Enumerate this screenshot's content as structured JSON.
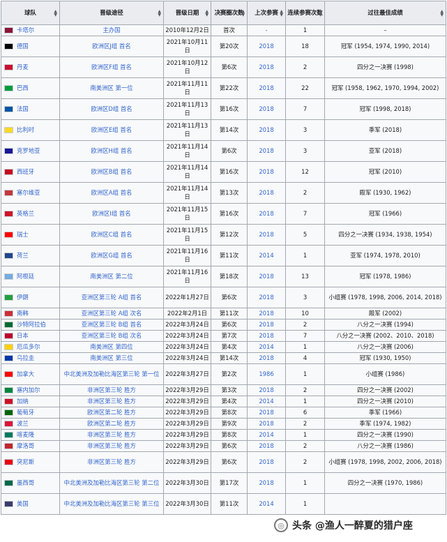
{
  "headers": [
    "球队",
    "晋级途径",
    "晋级日期",
    "决赛圈次数",
    "上次参赛",
    "连续参赛次数",
    "过往最佳成绩"
  ],
  "rows": [
    {
      "team": "卡塔尔",
      "flag": "#8a1538",
      "route": "主办国",
      "date": "2010年12月2日",
      "apps": "首次",
      "last": "-",
      "streak": "1",
      "best": "–"
    },
    {
      "team": "德国",
      "flag": "#000000",
      "route": "欧洲区J组 首名",
      "date": "2021年10月11日",
      "apps": "第20次",
      "last": "2018",
      "streak": "18",
      "best": "冠军 (1954, 1974, 1990, 2014)"
    },
    {
      "team": "丹麦",
      "flag": "#c8102e",
      "route": "欧洲区F组 首名",
      "date": "2021年10月12日",
      "apps": "第6次",
      "last": "2018",
      "streak": "2",
      "best": "四分之一决赛 (1998)"
    },
    {
      "team": "巴西",
      "flag": "#009c3b",
      "route": "南美洲区 第一位",
      "date": "2021年11月11日",
      "apps": "第22次",
      "last": "2018",
      "streak": "22",
      "best": "冠军 (1958, 1962, 1970, 1994, 2002)"
    },
    {
      "team": "法国",
      "flag": "#0055a4",
      "route": "欧洲区D组 首名",
      "date": "2021年11月13日",
      "apps": "第16次",
      "last": "2018",
      "streak": "7",
      "best": "冠军 (1998, 2018)"
    },
    {
      "team": "比利时",
      "flag": "#fdda24",
      "route": "欧洲区E组 首名",
      "date": "2021年11月13日",
      "apps": "第14次",
      "last": "2018",
      "streak": "3",
      "best": "季军 (2018)"
    },
    {
      "team": "克罗地亚",
      "flag": "#171796",
      "route": "欧洲区H组 首名",
      "date": "2021年11月14日",
      "apps": "第6次",
      "last": "2018",
      "streak": "3",
      "best": "亚军 (2018)"
    },
    {
      "team": "西班牙",
      "flag": "#c60b1e",
      "route": "欧洲区B组 首名",
      "date": "2021年11月14日",
      "apps": "第16次",
      "last": "2018",
      "streak": "12",
      "best": "冠军 (2010)"
    },
    {
      "team": "塞尔维亚",
      "flag": "#c6363c",
      "route": "欧洲区A组 首名",
      "date": "2021年11月14日",
      "apps": "第13次",
      "last": "2018",
      "streak": "2",
      "best": "殿军 (1930, 1962)"
    },
    {
      "team": "英格兰",
      "flag": "#cf142b",
      "route": "欧洲区I组 首名",
      "date": "2021年11月15日",
      "apps": "第16次",
      "last": "2018",
      "streak": "7",
      "best": "冠军 (1966)"
    },
    {
      "team": "瑞士",
      "flag": "#ff0000",
      "route": "欧洲区C组 首名",
      "date": "2021年11月15日",
      "apps": "第12次",
      "last": "2018",
      "streak": "5",
      "best": "四分之一决赛 (1934, 1938, 1954)"
    },
    {
      "team": "荷兰",
      "flag": "#21468b",
      "route": "欧洲区G组 首名",
      "date": "2021年11月16日",
      "apps": "第11次",
      "last": "2014",
      "streak": "1",
      "best": "亚军 (1974, 1978, 2010)"
    },
    {
      "team": "阿根廷",
      "flag": "#74acdf",
      "route": "南美洲区 第二位",
      "date": "2021年11月16日",
      "apps": "第18次",
      "last": "2018",
      "streak": "13",
      "best": "冠军 (1978, 1986)"
    },
    {
      "team": "伊朗",
      "flag": "#239f40",
      "route": "亚洲区第三轮 A组 首名",
      "date": "2022年1月27日",
      "apps": "第6次",
      "last": "2018",
      "streak": "3",
      "best": "小组赛 (1978, 1998, 2006, 2014, 2018)"
    },
    {
      "team": "南韩",
      "flag": "#cd2e3a",
      "route": "亚洲区第三轮 A组 次名",
      "date": "2022年2月1日",
      "apps": "第11次",
      "last": "2018",
      "streak": "10",
      "best": "殿军 (2002)"
    },
    {
      "team": "沙特阿拉伯",
      "flag": "#006c35",
      "route": "亚洲区第三轮 B组 首名",
      "date": "2022年3月24日",
      "apps": "第6次",
      "last": "2018",
      "streak": "2",
      "best": "八分之一决赛 (1994)"
    },
    {
      "team": "日本",
      "flag": "#bc002d",
      "route": "亚洲区第三轮 B组 次名",
      "date": "2022年3月24日",
      "apps": "第7次",
      "last": "2018",
      "streak": "7",
      "best": "八分之一决赛 (2002、2010、2018)"
    },
    {
      "team": "厄瓜多尔",
      "flag": "#ffd100",
      "route": "南美洲区 第四位",
      "date": "2022年3月24日",
      "apps": "第4次",
      "last": "2014",
      "streak": "1",
      "best": "八分之一决赛 (2006)"
    },
    {
      "team": "乌拉圭",
      "flag": "#0038a8",
      "route": "南美洲区 第三位",
      "date": "2022年3月24日",
      "apps": "第14次",
      "last": "2018",
      "streak": "4",
      "best": "冠军 (1930, 1950)"
    },
    {
      "team": "加拿大",
      "flag": "#ff0000",
      "route": "中北美洲及加勒比海区第三轮 第一位",
      "date": "2022年3月27日",
      "apps": "第2次",
      "last": "1986",
      "streak": "1",
      "best": "小组赛 (1986)"
    },
    {
      "team": "塞内加尔",
      "flag": "#00853f",
      "route": "非洲区第三轮 胜方",
      "date": "2022年3月29日",
      "apps": "第3次",
      "last": "2018",
      "streak": "2",
      "best": "四分之一决赛 (2002)"
    },
    {
      "team": "加纳",
      "flag": "#ce1126",
      "route": "非洲区第三轮 胜方",
      "date": "2022年3月29日",
      "apps": "第4次",
      "last": "2014",
      "streak": "1",
      "best": "四分之一决赛 (2010)"
    },
    {
      "team": "葡萄牙",
      "flag": "#006600",
      "route": "欧洲区第二轮 胜方",
      "date": "2022年3月29日",
      "apps": "第8次",
      "last": "2018",
      "streak": "6",
      "best": "季军 (1966)"
    },
    {
      "team": "波兰",
      "flag": "#dc143c",
      "route": "欧洲区第二轮 胜方",
      "date": "2022年3月29日",
      "apps": "第9次",
      "last": "2018",
      "streak": "2",
      "best": "季军 (1974, 1982)"
    },
    {
      "team": "喀麦隆",
      "flag": "#007a5e",
      "route": "非洲区第三轮 胜方",
      "date": "2022年3月29日",
      "apps": "第8次",
      "last": "2014",
      "streak": "1",
      "best": "四分之一决赛 (1990)"
    },
    {
      "team": "摩洛哥",
      "flag": "#c1272d",
      "route": "非洲区第三轮 胜方",
      "date": "2022年3月29日",
      "apps": "第6次",
      "last": "2018",
      "streak": "2",
      "best": "八分之一决赛 (1986)"
    },
    {
      "team": "突尼斯",
      "flag": "#e70013",
      "route": "非洲区第三轮 胜方",
      "date": "2022年3月29日",
      "apps": "第6次",
      "last": "2018",
      "streak": "2",
      "best": "小组赛 (1978, 1998, 2002, 2006, 2018)"
    },
    {
      "team": "墨西哥",
      "flag": "#006847",
      "route": "中北美洲及加勒比海区第三轮 第二位",
      "date": "2022年3月30日",
      "apps": "第17次",
      "last": "2018",
      "streak": "1",
      "best": "四分之一决赛 (1970, 1986)"
    },
    {
      "team": "美国",
      "flag": "#3c3b6e",
      "route": "中北美洲及加勒比海区第三轮 第三位",
      "date": "2022年3月30日",
      "apps": "第11次",
      "last": "2014",
      "streak": "1",
      "best": ""
    }
  ],
  "watermark": "头条 @渔人一醉夏的猎户座"
}
